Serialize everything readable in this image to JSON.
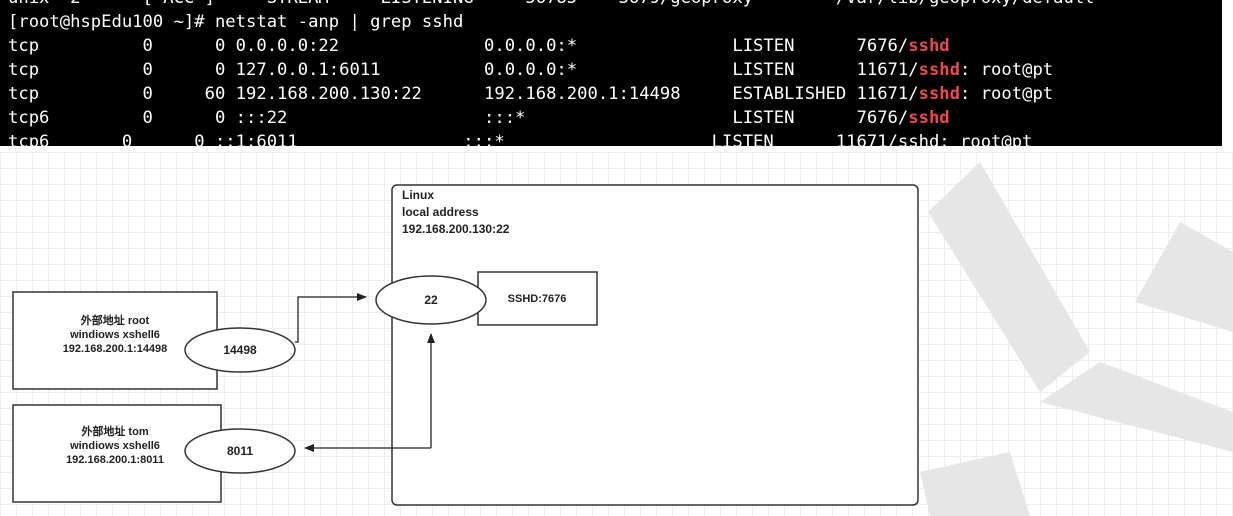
{
  "terminal": {
    "top_partial": "unix  2      [ ACC ]     STREAM     LISTENING     56785    3679/geoproxy        /var/lib/geoproxy/default",
    "prompt": "[root@hspEdu100 ~]# netstat -anp | grep sshd",
    "rows": [
      {
        "proto": "tcp",
        "recvq": "0",
        "sendq": "0",
        "local": "0.0.0.0:22",
        "foreign": "0.0.0.0:*",
        "state": "LISTEN",
        "pid": "7676/",
        "prog": "sshd",
        "extra": ""
      },
      {
        "proto": "tcp",
        "recvq": "0",
        "sendq": "0",
        "local": "127.0.0.1:6011",
        "foreign": "0.0.0.0:*",
        "state": "LISTEN",
        "pid": "11671/",
        "prog": "sshd",
        "extra": ": root@pt"
      },
      {
        "proto": "tcp",
        "recvq": "0",
        "sendq": "60",
        "local": "192.168.200.130:22",
        "foreign": "192.168.200.1:14498",
        "state": "ESTABLISHED",
        "pid": "11671/",
        "prog": "sshd",
        "extra": ": root@pt"
      },
      {
        "proto": "tcp6",
        "recvq": "0",
        "sendq": "0",
        "local": ":::22",
        "foreign": ":::*",
        "state": "LISTEN",
        "pid": "7676/",
        "prog": "sshd",
        "extra": ""
      }
    ],
    "bottom_partial": "tcp6       0      0 ::1:6011                :::*                    LISTEN      11671/sshd: root@pt"
  },
  "diagram": {
    "linux_box": {
      "line1": "Linux",
      "line2": "local address",
      "line3": "192.168.200.130:22"
    },
    "port_22": "22",
    "sshd_box": "SSHD:7676",
    "client_root": {
      "line1": "外部地址 root",
      "line2": "windiows xshell6",
      "line3": "192.168.200.1:14498",
      "port": "14498"
    },
    "client_tom": {
      "line1": "外部地址 tom",
      "line2": "windiows xshell6",
      "line3": "192.168.200.1:8011",
      "port": "8011"
    }
  },
  "colors": {
    "terminal_bg": "#000000",
    "terminal_text": "#ffffff",
    "highlight": "#f0474b",
    "watermark": "#e6e6e6"
  }
}
